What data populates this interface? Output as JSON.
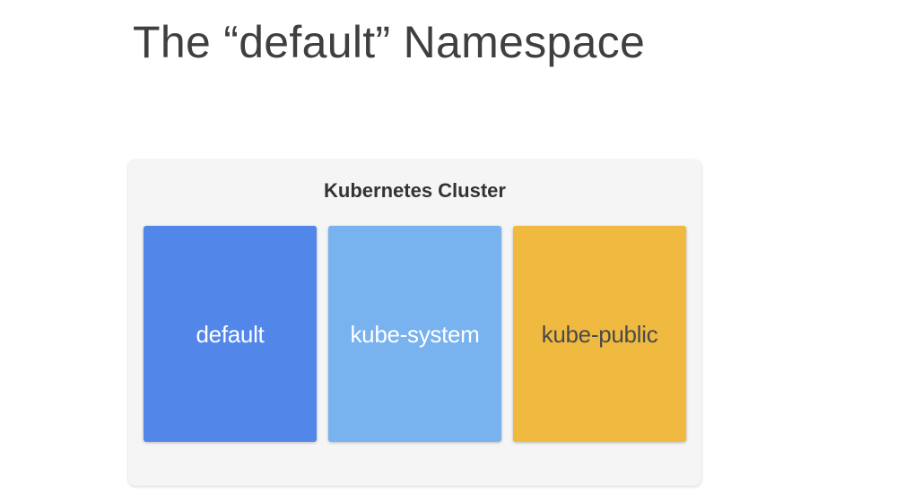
{
  "title": "The “default” Namespace",
  "cluster": {
    "title": "Kubernetes Cluster",
    "namespaces": [
      {
        "label": "default",
        "color": "#5286E9",
        "text_color": "#ffffff"
      },
      {
        "label": "kube-system",
        "color": "#78B2EF",
        "text_color": "#ffffff"
      },
      {
        "label": "kube-public",
        "color": "#F0BA41",
        "text_color": "#4a4a4a"
      }
    ]
  }
}
